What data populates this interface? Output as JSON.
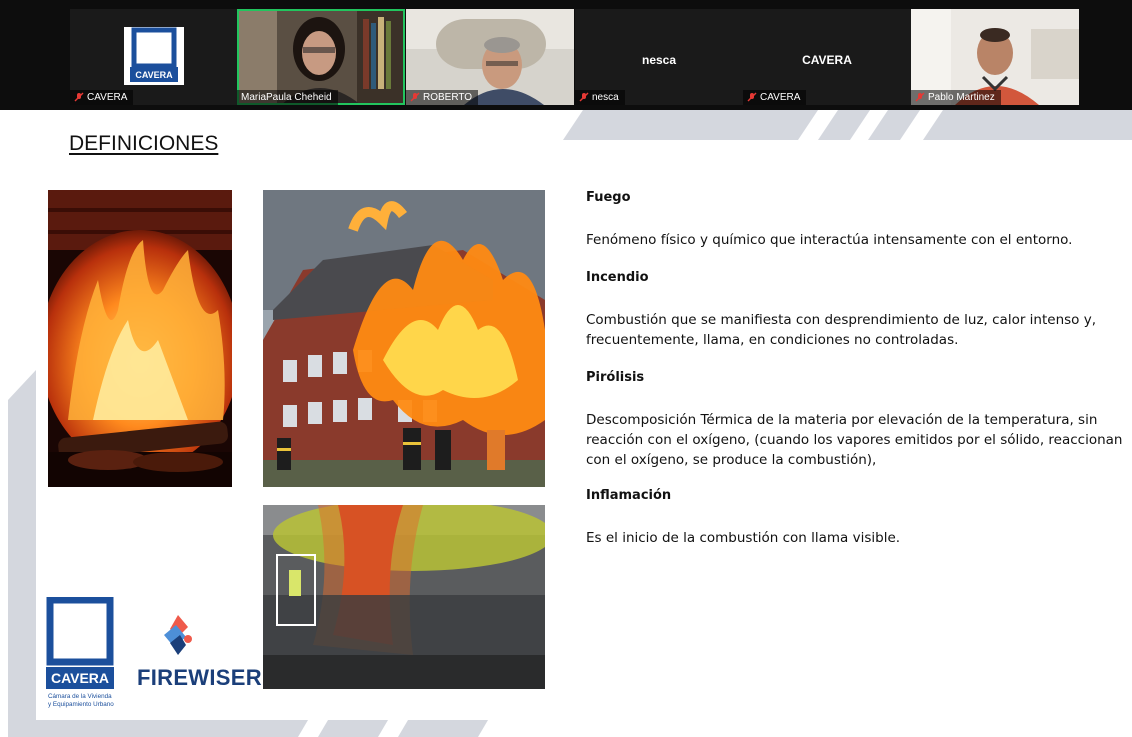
{
  "meeting": {
    "participants": [
      {
        "name": "CAVERA",
        "muted": true,
        "kind": "logo"
      },
      {
        "name": "MariaPaula Cheheid",
        "muted": false,
        "kind": "video",
        "active": true
      },
      {
        "name": "ROBERTO",
        "muted": true,
        "kind": "video"
      },
      {
        "name": "nesca",
        "muted": true,
        "kind": "text",
        "center_label": "nesca"
      },
      {
        "name": "CAVERA",
        "muted": true,
        "kind": "text",
        "center_label": "CAVERA"
      },
      {
        "name": "Pablo Martinez",
        "muted": true,
        "kind": "video"
      }
    ],
    "colors": {
      "active_border": "#22c55e",
      "mute_icon": "#e53935"
    }
  },
  "slide": {
    "title": "DEFINICIONES",
    "definitions": [
      {
        "term": "Fuego",
        "text": " Fenómeno físico y químico que interactúa intensamente con el entorno."
      },
      {
        "term": "Incendio",
        "text": "Combustión que se manifiesta con desprendimiento de luz, calor intenso y, frecuentemente, llama, en condiciones no controladas."
      },
      {
        "term": "Pirólisis",
        "text": "Descomposición Térmica de la materia por elevación de la temperatura, sin reacción con el oxígeno, (cuando los vapores emitidos por el sólido, reaccionan con el oxígeno, se produce la combustión),"
      },
      {
        "term": "Inflamación",
        "text": "Es el inicio de la combustión con llama visible."
      }
    ],
    "logos": {
      "cavera": {
        "name": "CAVERA",
        "tagline_1": "Cámara de la Vivienda",
        "tagline_2": "y Equipamiento Urbano"
      },
      "firewiser": {
        "name": "FIREWISER"
      }
    },
    "images": [
      "fireplace-photo",
      "burning-building-photo",
      "thermal-camera-photo"
    ],
    "colors": {
      "brand_blue": "#1b4f9c",
      "stripe_gray": "#d4d7de"
    }
  }
}
